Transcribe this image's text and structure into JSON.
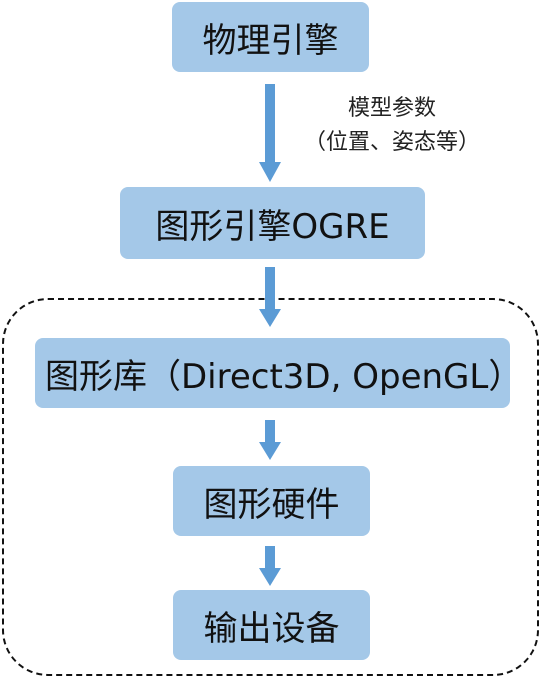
{
  "nodes": [
    {
      "id": "physics",
      "label": "物理引擎"
    },
    {
      "id": "ogre",
      "label": "图形引擎OGRE"
    },
    {
      "id": "graphics-lib",
      "label": "图形库（Direct3D, OpenGL）"
    },
    {
      "id": "hardware",
      "label": "图形硬件"
    },
    {
      "id": "output",
      "label": "输出设备"
    }
  ],
  "edge_label": {
    "line1": "模型参数",
    "line2": "（位置、姿态等）"
  },
  "colors": {
    "box_fill": "#a4c8e8",
    "arrow": "#5b9bd5",
    "dashed_border": "#111111"
  }
}
